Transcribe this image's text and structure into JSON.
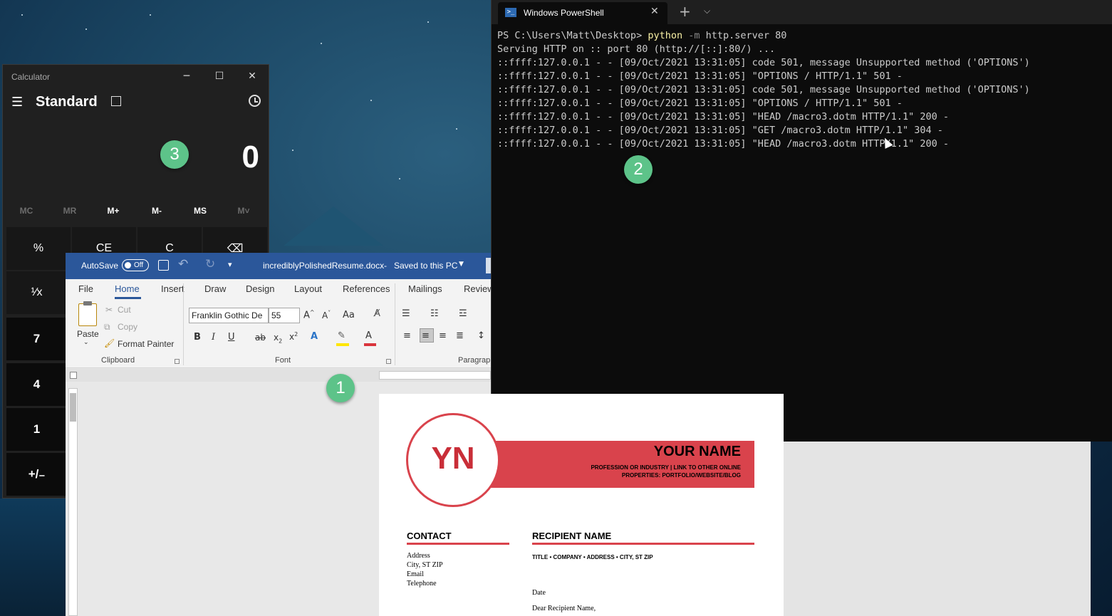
{
  "calculator": {
    "title": "Calculator",
    "mode": "Standard",
    "display": "0",
    "memory": [
      "MC",
      "MR",
      "M+",
      "M-",
      "MS",
      "M˅"
    ],
    "keys": {
      "percent": "%",
      "ce": "CE",
      "c": "C",
      "reciprocal": "¹⁄x",
      "seven": "7",
      "four": "4",
      "one": "1",
      "negate": "+/₋"
    }
  },
  "powershell": {
    "tab_title": "Windows PowerShell",
    "lines": [
      {
        "prompt": "PS C:\\Users\\Matt\\Desktop> ",
        "cmd": "python",
        "flag": " -m",
        "rest": " http.server 80"
      },
      {
        "text": "Serving HTTP on :: port 80 (http://[::]:80/) ..."
      },
      {
        "text": "::ffff:127.0.0.1 - - [09/Oct/2021 13:31:05] code 501, message Unsupported method ('OPTIONS')"
      },
      {
        "text": "::ffff:127.0.0.1 - - [09/Oct/2021 13:31:05] \"OPTIONS / HTTP/1.1\" 501 -"
      },
      {
        "text": "::ffff:127.0.0.1 - - [09/Oct/2021 13:31:05] code 501, message Unsupported method ('OPTIONS')"
      },
      {
        "text": "::ffff:127.0.0.1 - - [09/Oct/2021 13:31:05] \"OPTIONS / HTTP/1.1\" 501 -"
      },
      {
        "text": "::ffff:127.0.0.1 - - [09/Oct/2021 13:31:05] \"HEAD /macro3.dotm HTTP/1.1\" 200 -"
      },
      {
        "text": "::ffff:127.0.0.1 - - [09/Oct/2021 13:31:05] \"GET /macro3.dotm HTTP/1.1\" 304 -"
      },
      {
        "text": "::ffff:127.0.0.1 - - [09/Oct/2021 13:31:05] \"HEAD /macro3.dotm HTTP/1.1\" 200 -"
      }
    ]
  },
  "word": {
    "autosave_label": "AutoSave",
    "autosave_state": "Off",
    "doc_title": "incrediblyPolishedResume.docx",
    "save_status": "Saved to this PC",
    "tabs": [
      "File",
      "Home",
      "Insert",
      "Draw",
      "Design",
      "Layout",
      "References",
      "Mailings",
      "Review"
    ],
    "active_tab": "Home",
    "clipboard": {
      "paste": "Paste",
      "cut": "Cut",
      "copy": "Copy",
      "format_painter": "Format Painter",
      "group": "Clipboard"
    },
    "font": {
      "family": "Franklin Gothic De",
      "size": "55",
      "group": "Font",
      "case": "Aa"
    },
    "paragraph_group": "Paragraph"
  },
  "resume": {
    "initials": "YN",
    "name": "YOUR NAME",
    "tagline_1": "PROFESSION OR INDUSTRY | LINK TO OTHER ONLINE",
    "tagline_2": "PROPERTIES: PORTFOLIO/WEBSITE/BLOG",
    "contact_heading": "CONTACT",
    "contact_lines": [
      "Address",
      "City, ST ZIP",
      "Email",
      "Telephone"
    ],
    "recipient_heading": "RECIPIENT NAME",
    "recipient_sub": "TITLE • COMPANY • ADDRESS • CITY, ST ZIP",
    "date": "Date",
    "salutation": "Dear Recipient Name,"
  },
  "badges": [
    "1",
    "2",
    "3"
  ],
  "colors": {
    "word_blue": "#2b579a",
    "resume_red": "#d9434c",
    "badge_green": "#5dc389"
  }
}
